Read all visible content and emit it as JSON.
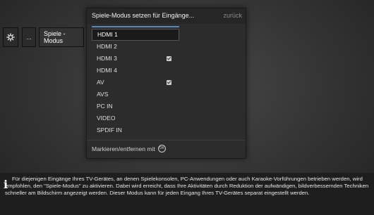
{
  "menu": {
    "dots_label": "...",
    "mode_label": "Spiele -\nModus"
  },
  "dialog": {
    "title": "Spiele-Modus setzen für Eingänge...",
    "back_label": "zurück",
    "items": [
      {
        "label": "HDMI 1",
        "checked": false,
        "selected": true
      },
      {
        "label": "HDMI 2",
        "checked": false,
        "selected": false
      },
      {
        "label": "HDMI 3",
        "checked": true,
        "selected": false
      },
      {
        "label": "HDMI 4",
        "checked": false,
        "selected": false
      },
      {
        "label": "AV",
        "checked": true,
        "selected": false
      },
      {
        "label": "AVS",
        "checked": false,
        "selected": false
      },
      {
        "label": "PC IN",
        "checked": false,
        "selected": false
      },
      {
        "label": "VIDEO",
        "checked": false,
        "selected": false
      },
      {
        "label": "SPDIF IN",
        "checked": false,
        "selected": false
      }
    ],
    "footer_label": "Markieren/entfernen mit",
    "footer_icon": "ok-button-icon",
    "ok_icon_text": "OK"
  },
  "info": {
    "icon": "info-icon",
    "text": "Für diejenigen Eingänge Ihres TV-Gerätes, an denen Spielekonsolen, PC-Anwendungen oder auch Karaoke-Vorführungen betrieben werden, wird empfohlen, den \"Spiele-Modus\" zu aktivieren. Dabei wird erreicht, dass Ihre Aktivitäten durch Reduktion der aufwändigen, bildverbessernden Techniken schneller am Bildschirm angezeigt werden. Dieser Modus kann für jeden Eingang Ihres TV-Gerätes separat eingestellt werden."
  },
  "colors": {
    "accent": "#5a86b8",
    "background": "#333333",
    "dialog": "#2c2c2c"
  }
}
